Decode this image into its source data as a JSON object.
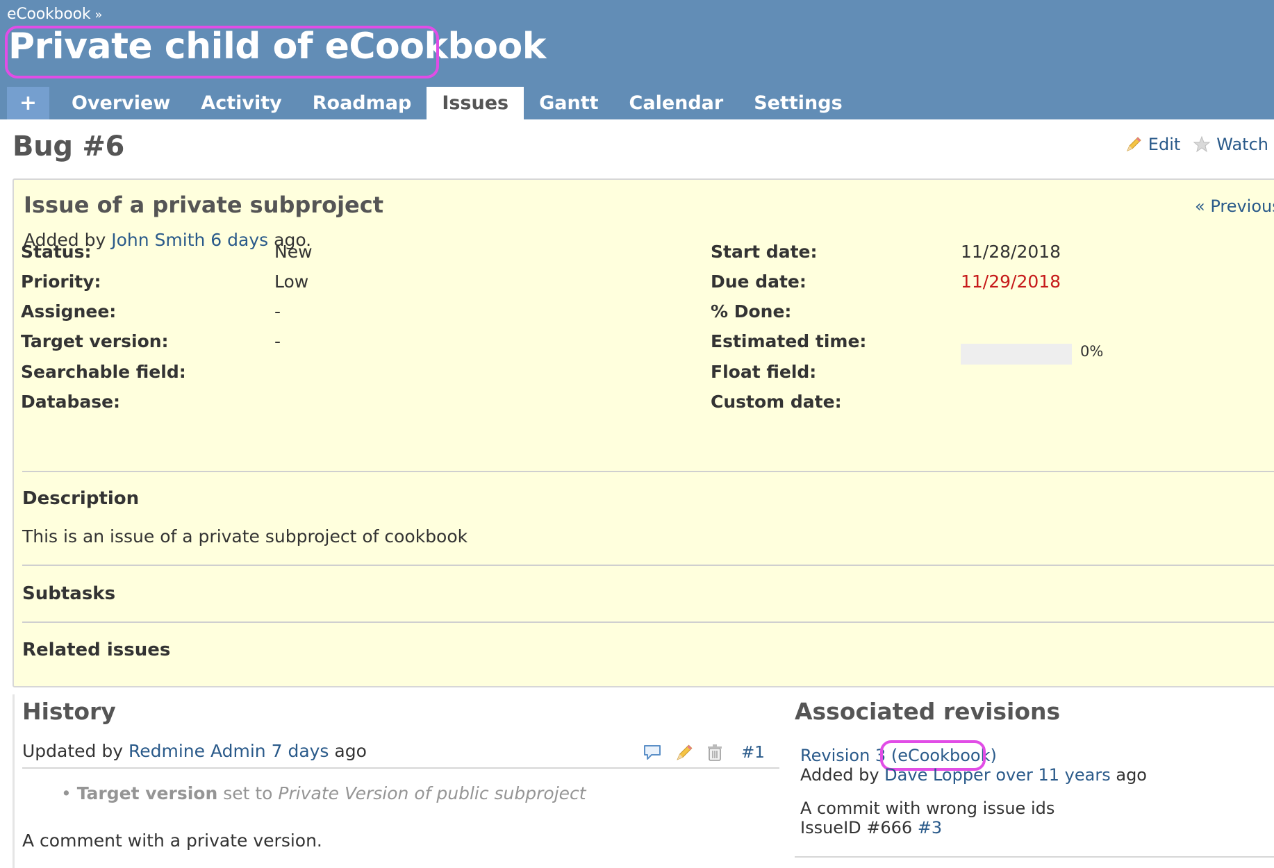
{
  "header": {
    "breadcrumb": "eCookbook",
    "breadcrumb_sep": "»",
    "project_title": "Private child of eCookbook"
  },
  "menu": {
    "new": "+",
    "tabs": [
      {
        "label": "Overview"
      },
      {
        "label": "Activity"
      },
      {
        "label": "Roadmap"
      },
      {
        "label": "Issues"
      },
      {
        "label": "Gantt"
      },
      {
        "label": "Calendar"
      },
      {
        "label": "Settings"
      }
    ],
    "selected": "Issues"
  },
  "issue": {
    "heading": "Bug #6",
    "actions": {
      "edit": "Edit",
      "watch": "Watch"
    },
    "subject": "Issue of a private subproject",
    "previous": "« Previous",
    "author_prefix": "Added by",
    "author": "John Smith",
    "age": "6 days",
    "age_suffix": "ago.",
    "attributes": {
      "status": {
        "label": "Status:",
        "value": "New"
      },
      "priority": {
        "label": "Priority:",
        "value": "Low"
      },
      "assignee": {
        "label": "Assignee:",
        "value": "-"
      },
      "target_version": {
        "label": "Target version:",
        "value": "-"
      },
      "searchable_field": {
        "label": "Searchable field:",
        "value": ""
      },
      "database": {
        "label": "Database:",
        "value": ""
      },
      "start_date": {
        "label": "Start date:",
        "value": "11/28/2018"
      },
      "due_date": {
        "label": "Due date:",
        "value": "11/29/2018"
      },
      "done": {
        "label": "% Done:",
        "value": "0%",
        "fraction": 0
      },
      "estimated_time": {
        "label": "Estimated time:",
        "value": ""
      },
      "float_field": {
        "label": "Float field:",
        "value": ""
      },
      "custom_date": {
        "label": "Custom date:",
        "value": ""
      }
    },
    "description_title": "Description",
    "description": "This is an issue of a private subproject of cookbook",
    "subtasks_title": "Subtasks",
    "related_title": "Related issues"
  },
  "history": {
    "title": "History",
    "journal": {
      "prefix": "Updated by",
      "user": "Redmine Admin",
      "age": "7 days",
      "suffix": "ago",
      "number": "#1",
      "detail_field": "Target version",
      "detail_middle": "set to",
      "detail_value": "Private Version of public subproject",
      "comment": "A comment with a private version."
    }
  },
  "revisions": {
    "title": "Associated revisions",
    "revision": "Revision 3",
    "repository": "(eCookbook)",
    "added_prefix": "Added by",
    "author": "Dave Lopper",
    "age": "over 11 years",
    "age_suffix": "ago",
    "message_line1": "A commit with wrong issue ids",
    "message_line2_prefix": "IssueID #666",
    "message_line2_link": "#3"
  },
  "colors": {
    "header": "#628db6",
    "issue_bg": "#ffffdd",
    "link": "#2a5a8a",
    "overdue": "#c61a1a",
    "highlight": "#e14de6"
  }
}
